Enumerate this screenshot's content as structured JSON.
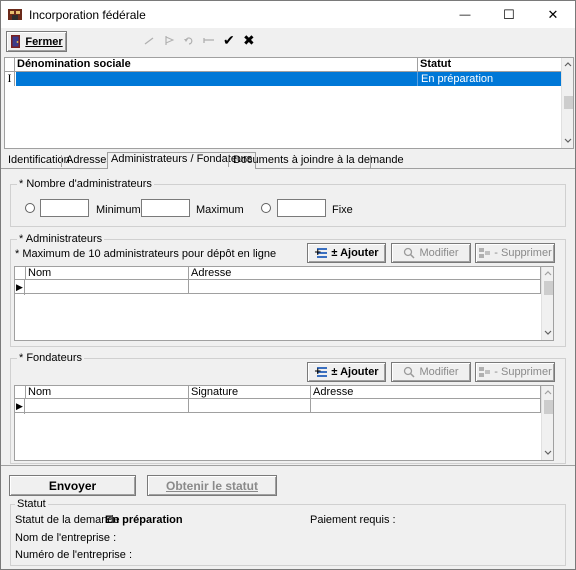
{
  "window": {
    "title": "Incorporation fédérale",
    "minimize": "—",
    "maximize": "☐",
    "close": "✕"
  },
  "toolbar": {
    "close_button": "Fermer",
    "icons": [
      "first-icon",
      "next-icon",
      "refresh-icon",
      "last-icon",
      "check-icon",
      "cancel-icon"
    ],
    "check_glyph": "✔",
    "cancel_glyph": "✖"
  },
  "top_grid": {
    "columns": [
      "Dénomination sociale",
      "Statut"
    ],
    "rows": [
      {
        "denomination": "",
        "statut": "En préparation"
      }
    ],
    "row_indicator": "I"
  },
  "tabs": [
    {
      "label": "Identification",
      "active": false
    },
    {
      "label": "Adresses",
      "active": false
    },
    {
      "label": "Administrateurs / Fondateurs",
      "active": true
    },
    {
      "label": "Documents à joindre à la demande",
      "active": false
    }
  ],
  "nombre_admins": {
    "title": "* Nombre d'administrateurs",
    "minimum_label": "Minimum",
    "maximum_label": "Maximum",
    "fixe_label": "Fixe",
    "minimum_value": "",
    "maximum_value": "",
    "fixe_value": ""
  },
  "administrateurs": {
    "title": "* Administrateurs",
    "note": "* Maximum de 10 administrateurs pour dépôt en ligne",
    "add_button": "± Ajouter",
    "modify_button": "Modifier",
    "delete_button": "- Supprimer",
    "columns": [
      "Nom",
      "Adresse"
    ],
    "rows": [
      {
        "nom": "",
        "adresse": ""
      }
    ]
  },
  "fondateurs": {
    "title": "* Fondateurs",
    "add_button": "± Ajouter",
    "modify_button": "Modifier",
    "delete_button": "- Supprimer",
    "columns": [
      "Nom",
      "Signature",
      "Adresse"
    ],
    "rows": [
      {
        "nom": "",
        "signature": "",
        "adresse": ""
      }
    ]
  },
  "actions": {
    "send_button": "Envoyer",
    "status_button": "Obtenir le statut"
  },
  "statut": {
    "title": "Statut",
    "demand_status_label": "Statut de la demande :",
    "demand_status_value": "En préparation",
    "payment_label": "Paiement requis :",
    "company_name_label": "Nom de l'entreprise :",
    "company_number_label": "Numéro de l'entreprise :"
  },
  "colors": {
    "selection": "#0078d7",
    "window_bg": "#f0f0f0"
  }
}
